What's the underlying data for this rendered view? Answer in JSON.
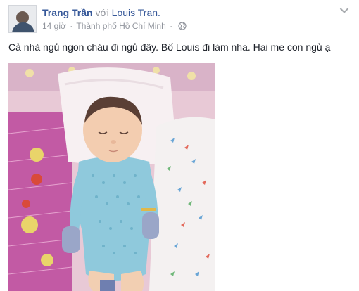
{
  "post": {
    "author": "Trang Trần",
    "with_word": "với",
    "tagged": "Louis Tran.",
    "time": "14 giờ",
    "separator": "·",
    "location": "Thành phố Hồ Chí Minh",
    "privacy_separator": "·",
    "privacy_icon": "globe-icon",
    "options_icon": "chevron-down-icon",
    "text": "Cả nhà ngủ ngon cháu đi ngủ đây. Bố Louis đi làm nha. Hai me con ngủ ạ",
    "photo_icon": "baby-photo"
  },
  "colors": {
    "link": "#365899",
    "meta": "#90949c",
    "body_text": "#1d2129"
  }
}
